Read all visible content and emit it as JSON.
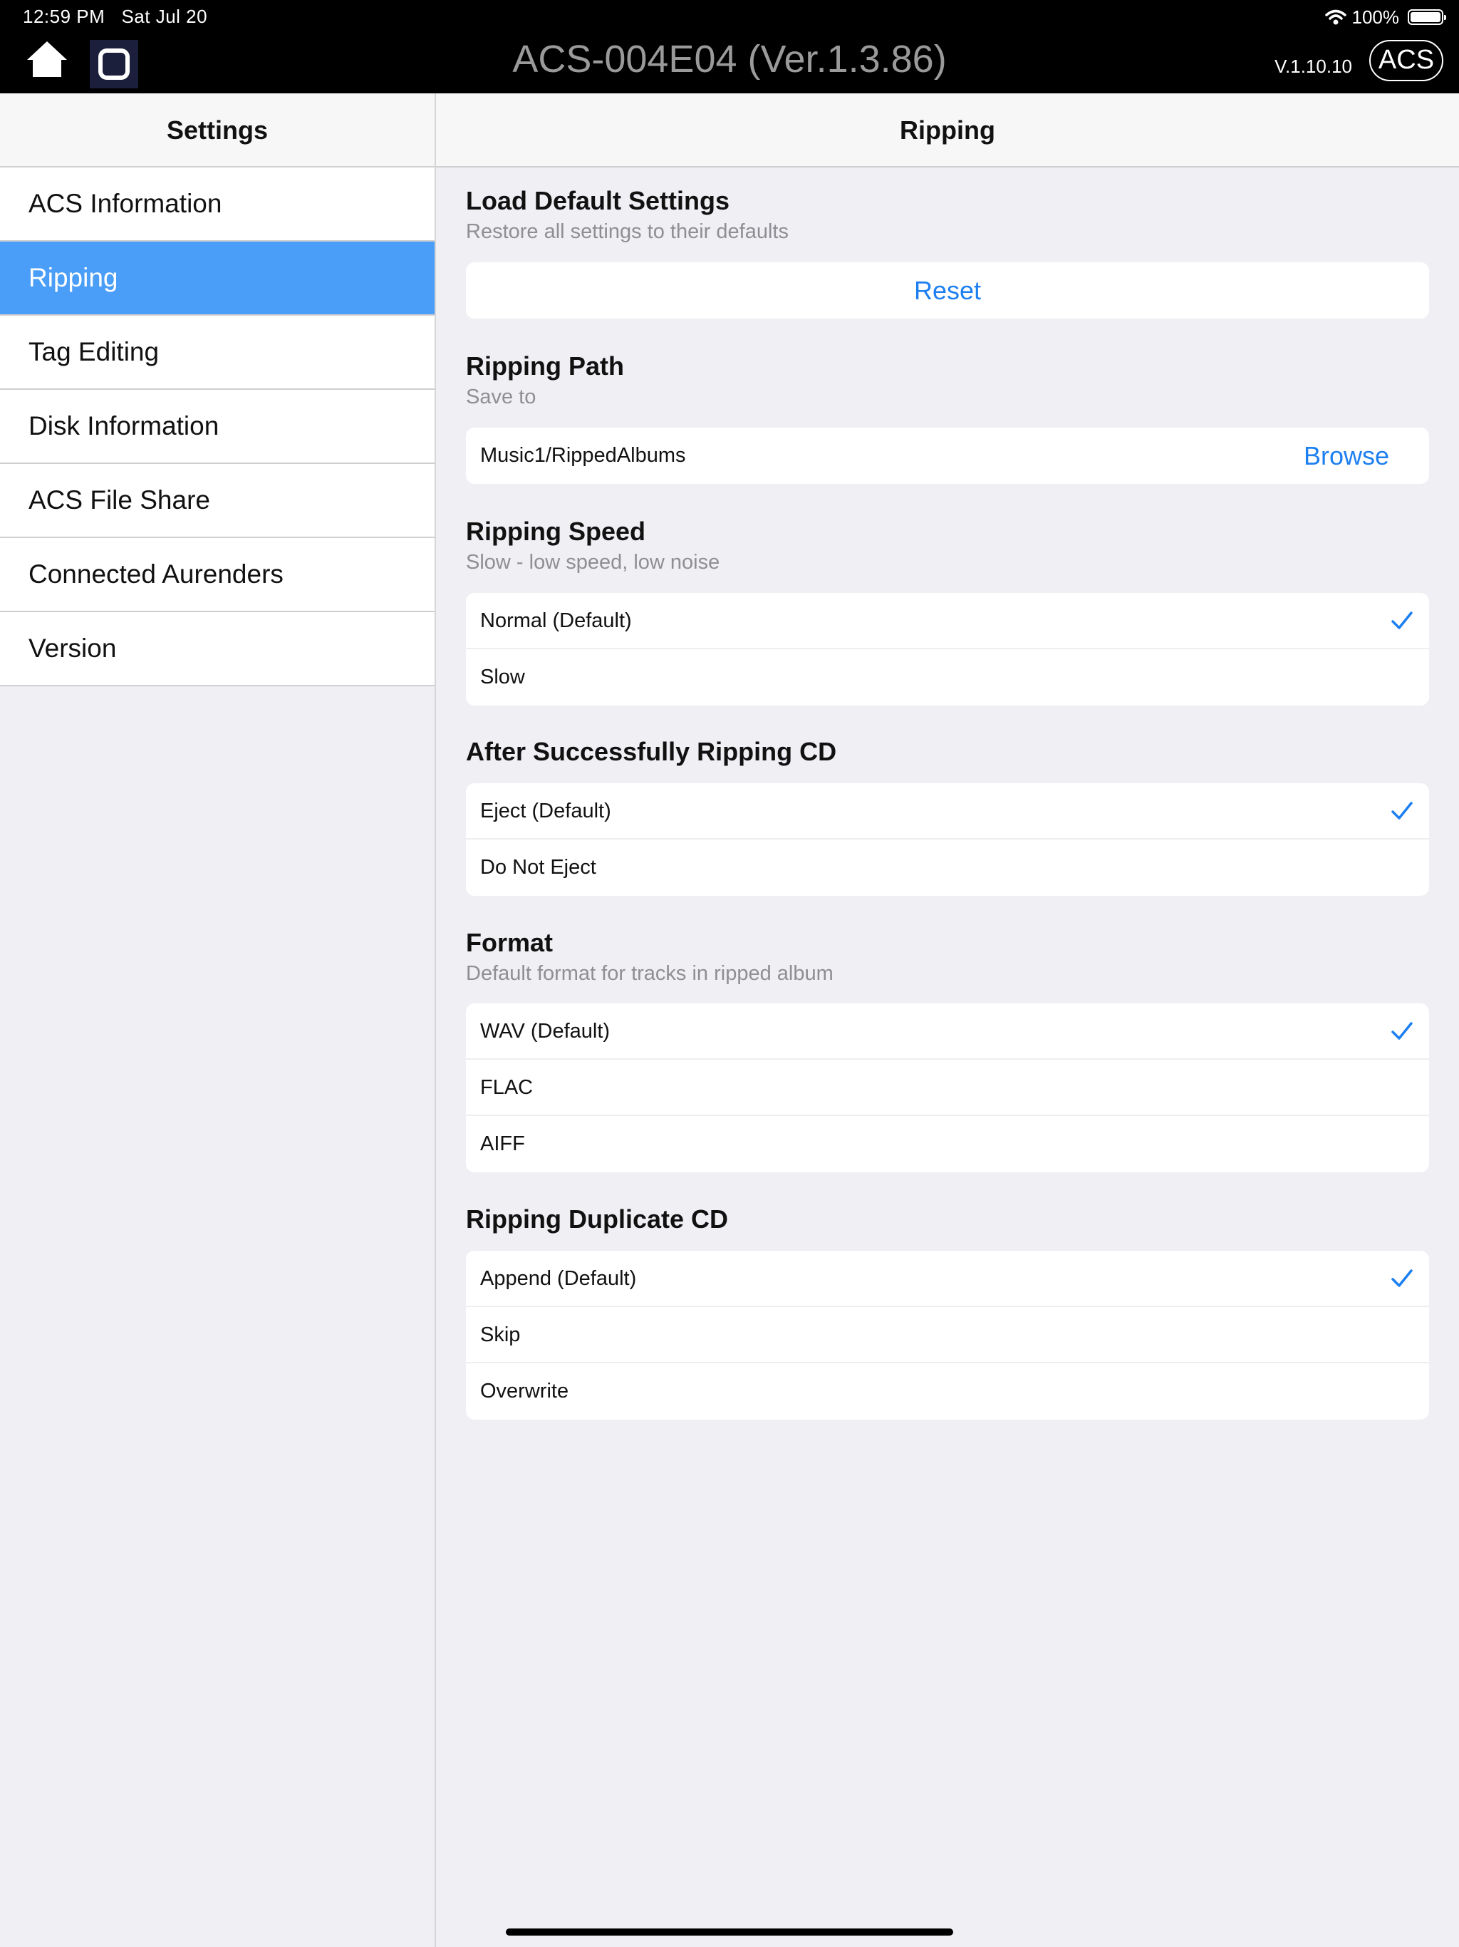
{
  "status": {
    "time": "12:59 PM   Sat Jul 20",
    "battery": "100%"
  },
  "topbar": {
    "device_title": "ACS-004E04 (Ver.1.3.86)",
    "app_version": "V.1.10.10",
    "acs_label": "ACS"
  },
  "sidebar": {
    "title": "Settings",
    "items": [
      {
        "label": "ACS Information",
        "selected": false
      },
      {
        "label": "Ripping",
        "selected": true
      },
      {
        "label": "Tag Editing",
        "selected": false
      },
      {
        "label": "Disk Information",
        "selected": false
      },
      {
        "label": "ACS File Share",
        "selected": false
      },
      {
        "label": "Connected Aurenders",
        "selected": false
      },
      {
        "label": "Version",
        "selected": false
      }
    ]
  },
  "main": {
    "title": "Ripping",
    "load_default": {
      "title": "Load Default Settings",
      "subtitle": "Restore all settings to their defaults",
      "reset_label": "Reset"
    },
    "ripping_path": {
      "title": "Ripping Path",
      "subtitle": "Save to",
      "path": "Music1/RippedAlbums",
      "browse_label": "Browse"
    },
    "ripping_speed": {
      "title": "Ripping Speed",
      "subtitle": "Slow - low speed, low noise",
      "options": [
        {
          "label": "Normal (Default)",
          "checked": true
        },
        {
          "label": "Slow",
          "checked": false
        }
      ]
    },
    "after_ripping": {
      "title": "After Successfully Ripping CD",
      "options": [
        {
          "label": "Eject (Default)",
          "checked": true
        },
        {
          "label": "Do Not Eject",
          "checked": false
        }
      ]
    },
    "format": {
      "title": "Format",
      "subtitle": "Default format for tracks in ripped album",
      "options": [
        {
          "label": "WAV (Default)",
          "checked": true
        },
        {
          "label": "FLAC",
          "checked": false
        },
        {
          "label": "AIFF",
          "checked": false
        }
      ]
    },
    "duplicate": {
      "title": "Ripping Duplicate CD",
      "options": [
        {
          "label": "Append (Default)",
          "checked": true
        },
        {
          "label": "Skip",
          "checked": false
        },
        {
          "label": "Overwrite",
          "checked": false
        }
      ]
    }
  },
  "colors": {
    "accent": "#1d7ff0",
    "selected_bg": "#4a9ef7",
    "background": "#efeff4"
  },
  "icons": {
    "home": "home-icon",
    "square": "app-square-icon",
    "wifi": "wifi-icon",
    "battery": "battery-icon",
    "check": "checkmark-icon"
  }
}
